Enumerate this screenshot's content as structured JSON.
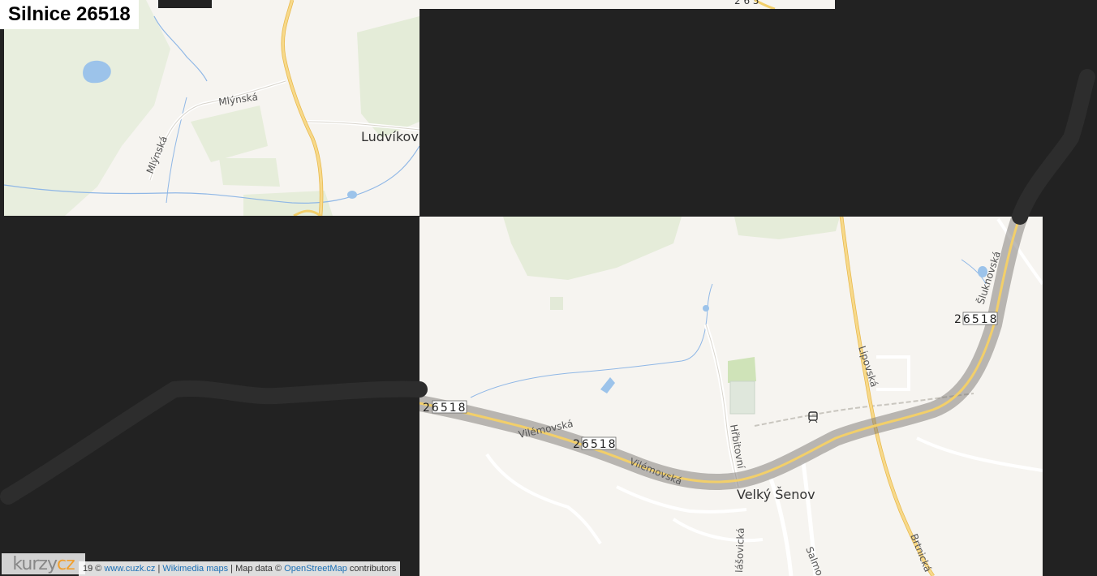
{
  "title": "Silnice 26518",
  "road_shields": [
    "26518",
    "26518",
    "26518"
  ],
  "partial_shield": "2 6 5",
  "streets": {
    "mlynska_1": "Mlýnská",
    "mlynska_2": "Mlýnská",
    "vilemovska_1": "Vilémovská",
    "vilemovska_2": "Vilémovská",
    "hrbitovni": "Hřbitovní",
    "lipovska": "Lipovská",
    "sluknovska": "Šluknovská",
    "brtnicka": "Brtnická",
    "salmovska": "Salmo",
    "plasovicka": "lášovická"
  },
  "places": {
    "ludvikov": "Ludvíkov",
    "velky_senov": "Velký Šenov"
  },
  "attribution": {
    "prefix": "19 © ",
    "cuzk": "www.cuzk.cz",
    "sep1": " | ",
    "wikimedia": "Wikimedia maps",
    "mapdata": " | Map data © ",
    "osm": "OpenStreetMap",
    "suffix": " contributors"
  },
  "logo": {
    "main": "kurzy",
    "accent": "cz"
  },
  "colors": {
    "background": "#222222",
    "land": "#f6f4f0",
    "forest": "#e6eddc",
    "water": "#8fb7e6",
    "major_road": "#f2cf6a",
    "route_highlight": "#6e6e6e"
  }
}
